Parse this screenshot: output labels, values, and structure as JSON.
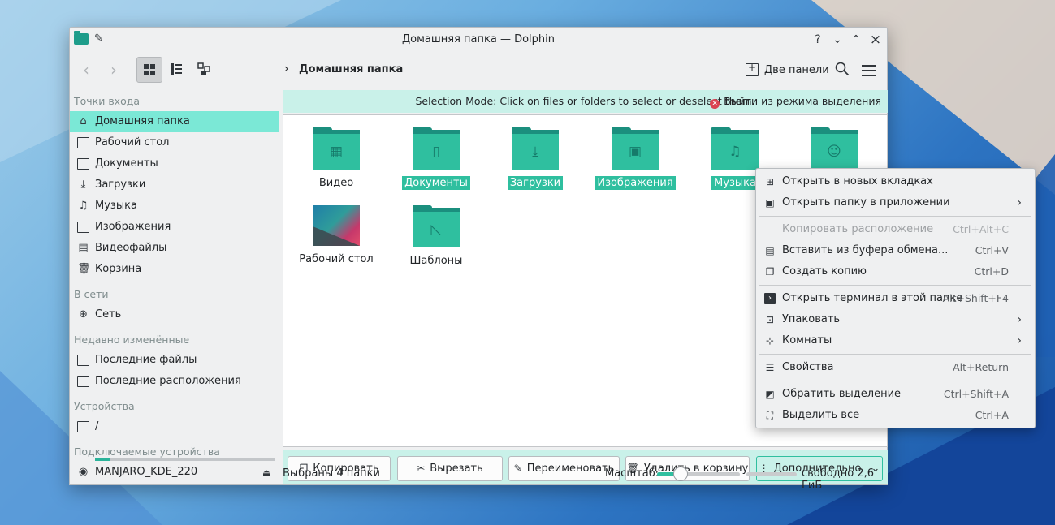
{
  "window": {
    "title": "Домашняя папка — Dolphin",
    "controls": {
      "help": "?",
      "minimize": "⌄",
      "maximize": "⌃",
      "close": "×"
    }
  },
  "toolbar": {
    "breadcrumb": "Домашняя папка",
    "dual_panel_label": "Две панели",
    "view_modes": [
      "icons",
      "details",
      "tree"
    ]
  },
  "sidebar": {
    "sections": {
      "places": "Точки входа",
      "network": "В сети",
      "recent": "Недавно изменённые",
      "devices": "Устройства",
      "removable": "Подключаемые устройства"
    },
    "places": [
      {
        "label": "Домашняя папка",
        "icon": "home-icon"
      },
      {
        "label": "Рабочий стол",
        "icon": "desktop-icon"
      },
      {
        "label": "Документы",
        "icon": "documents-icon"
      },
      {
        "label": "Загрузки",
        "icon": "downloads-icon"
      },
      {
        "label": "Музыка",
        "icon": "music-icon"
      },
      {
        "label": "Изображения",
        "icon": "images-icon"
      },
      {
        "label": "Видеофайлы",
        "icon": "videos-icon"
      },
      {
        "label": "Корзина",
        "icon": "trash-icon"
      }
    ],
    "network": [
      {
        "label": "Сеть",
        "icon": "network-icon"
      }
    ],
    "recent": [
      {
        "label": "Последние файлы",
        "icon": "recent-files-icon"
      },
      {
        "label": "Последние расположения",
        "icon": "recent-locations-icon"
      }
    ],
    "devices": [
      {
        "label": "/",
        "icon": "drive-icon",
        "usage_fraction": 0.08
      }
    ],
    "removable": [
      {
        "label": "MANJARO_KDE_220",
        "icon": "disc-icon"
      }
    ]
  },
  "selection_banner": {
    "text": "Selection Mode: Click on files or folders to select or deselect them.",
    "exit_label": "Выйти из режима выделения"
  },
  "files": [
    {
      "label": "Видео",
      "emblem": "film-icon",
      "selected": false
    },
    {
      "label": "Документы",
      "emblem": "document-icon",
      "selected": true
    },
    {
      "label": "Загрузки",
      "emblem": "download-icon",
      "selected": true
    },
    {
      "label": "Изображения",
      "emblem": "image-icon",
      "selected": true
    },
    {
      "label": "Музыка",
      "emblem": "music-note-icon",
      "selected": true
    },
    {
      "label": "",
      "emblem": "users-icon",
      "selected": false
    },
    {
      "label": "Рабочий стол",
      "emblem": "thumbnail",
      "selected": false
    },
    {
      "label": "Шаблоны",
      "emblem": "template-icon",
      "selected": false
    }
  ],
  "action_bar": {
    "copy": "Копировать",
    "cut": "Вырезать",
    "rename": "Переименовать",
    "trash": "Удалить в корзину",
    "more": "Дополнительно"
  },
  "status_bar": {
    "text": "Выбраны 4 папки",
    "zoom_label": "Масштаб:",
    "zoom_fraction": 0.28,
    "free_space": "свободно 2,6 ГиБ"
  },
  "context_menu": {
    "items": [
      {
        "label": "Открыть в новых вкладках",
        "shortcut": "",
        "submenu": false,
        "disabled": false,
        "icon": "new-tab-icon"
      },
      {
        "label": "Открыть папку в приложении",
        "shortcut": "",
        "submenu": true,
        "disabled": false,
        "icon": "open-with-icon"
      },
      {
        "label": "Копировать расположение",
        "shortcut": "Ctrl+Alt+C",
        "submenu": false,
        "disabled": true,
        "icon": ""
      },
      {
        "label": "Вставить из буфера обмена...",
        "shortcut": "Ctrl+V",
        "submenu": false,
        "disabled": false,
        "icon": "paste-icon"
      },
      {
        "label": "Создать копию",
        "shortcut": "Ctrl+D",
        "submenu": false,
        "disabled": false,
        "icon": "duplicate-icon"
      },
      {
        "label": "Открыть терминал в этой папке",
        "shortcut": "Alt+Shift+F4",
        "submenu": false,
        "disabled": false,
        "icon": "terminal-icon"
      },
      {
        "label": "Упаковать",
        "shortcut": "",
        "submenu": true,
        "disabled": false,
        "icon": "archive-icon"
      },
      {
        "label": "Комнаты",
        "shortcut": "",
        "submenu": true,
        "disabled": false,
        "icon": "activities-icon"
      },
      {
        "label": "Свойства",
        "shortcut": "Alt+Return",
        "submenu": false,
        "disabled": false,
        "icon": "properties-icon"
      },
      {
        "label": "Обратить выделение",
        "shortcut": "Ctrl+Shift+A",
        "submenu": false,
        "disabled": false,
        "icon": "invert-selection-icon"
      },
      {
        "label": "Выделить все",
        "shortcut": "Ctrl+A",
        "submenu": false,
        "disabled": false,
        "icon": "select-all-icon"
      }
    ]
  },
  "colors": {
    "accent": "#2fbf9f",
    "selection_bg": "#7be8d6",
    "banner_bg": "#c9f1e9",
    "window_bg": "#eff0f1"
  }
}
